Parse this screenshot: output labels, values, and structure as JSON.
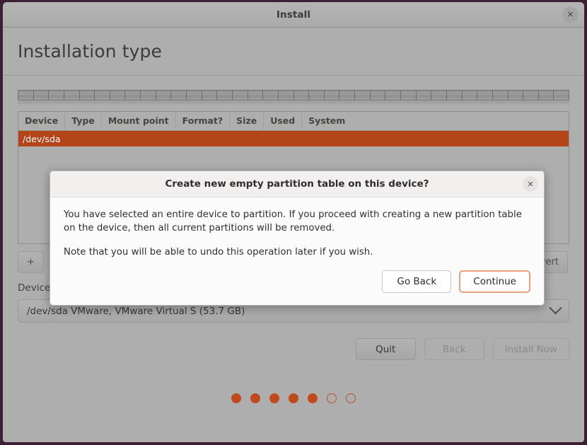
{
  "window": {
    "title": "Install",
    "close_icon": "close-icon"
  },
  "page": {
    "heading": "Installation type"
  },
  "partition_table": {
    "columns": [
      "Device",
      "Type",
      "Mount point",
      "Format?",
      "Size",
      "Used",
      "System"
    ],
    "rows": [
      {
        "device": "/dev/sda",
        "type": "",
        "mount_point": "",
        "format": "",
        "size": "",
        "used": "",
        "system": "",
        "selected": true
      }
    ]
  },
  "toolbar": {
    "add_label": "+",
    "revert_label": "vert"
  },
  "bootloader": {
    "label": "Device for boot loader installation:",
    "selected": "/dev/sda VMware, VMware Virtual S (53.7 GB)",
    "chevron_icon": "chevron-down-icon"
  },
  "nav": {
    "quit": "Quit",
    "back": "Back",
    "install_now": "Install Now"
  },
  "progress": {
    "total": 7,
    "completed": 5
  },
  "dialog": {
    "title": "Create new empty partition table on this device?",
    "close_icon": "close-icon",
    "paragraph1": "You have selected an entire device to partition. If you proceed with creating a new partition table on the device, then all current partitions will be removed.",
    "paragraph2": "Note that you will be able to undo this operation later if you wish.",
    "go_back": "Go Back",
    "continue": "Continue"
  },
  "colors": {
    "accent_orange": "#b34418",
    "dot_orange": "#bf4a1c",
    "focus_ring": "#e8a17d",
    "window_bg": "#aeaeae",
    "desktop_bg": "#3d1f33"
  }
}
